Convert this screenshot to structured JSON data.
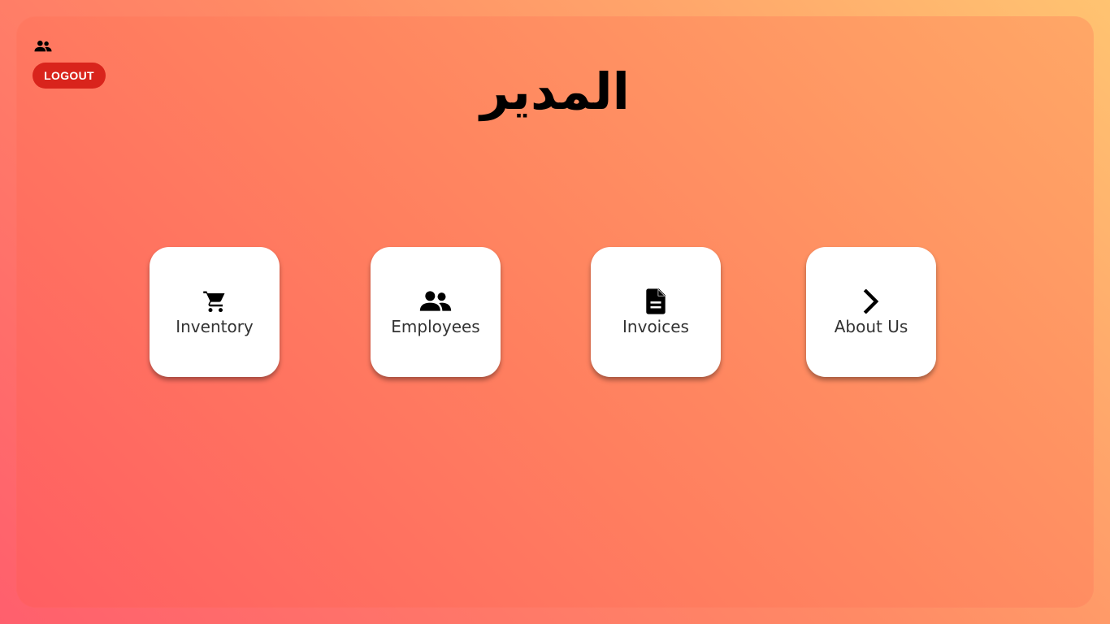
{
  "header": {
    "user_icon": "people-icon",
    "logout_label": "LOGOUT",
    "title": "المدير"
  },
  "tiles": [
    {
      "label": "Inventory",
      "icon": "cart-icon"
    },
    {
      "label": "Employees",
      "icon": "people-icon"
    },
    {
      "label": "Invoices",
      "icon": "document-icon"
    },
    {
      "label": "About Us",
      "icon": "chevron-right-icon"
    }
  ],
  "colors": {
    "logout_button": "#d9241c",
    "tile_background": "#ffffff",
    "gradient_start": "#ff5e62",
    "gradient_end": "#ffc371"
  }
}
